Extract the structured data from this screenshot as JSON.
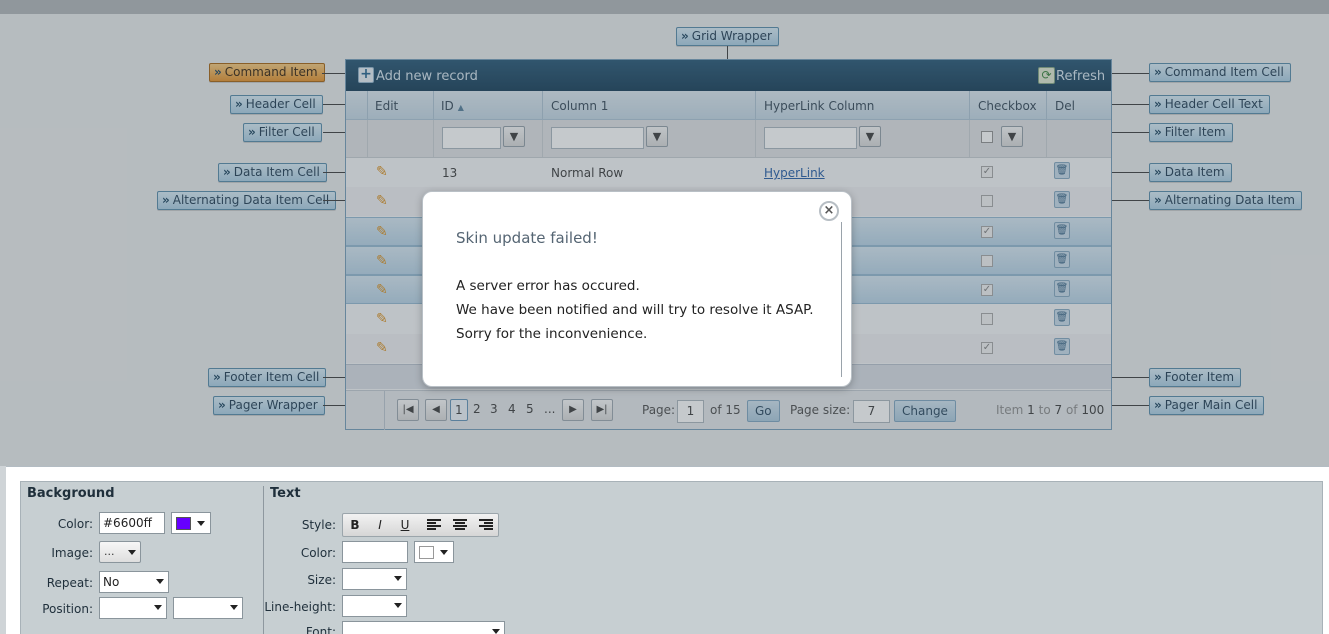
{
  "callouts": {
    "grid_wrapper": "Grid Wrapper",
    "command_item": "Command Item",
    "command_item_cell": "Command Item Cell",
    "header_cell": "Header Cell",
    "header_cell_text": "Header Cell Text",
    "filter_cell": "Filter Cell",
    "filter_item": "Filter Item",
    "data_item_cell": "Data Item Cell",
    "data_item": "Data Item",
    "alternating_data_item_cell": "Alternating Data Item Cell",
    "alternating_data_item": "Alternating Data Item",
    "footer_item_cell": "Footer Item Cell",
    "footer_item": "Footer Item",
    "pager_wrapper": "Pager Wrapper",
    "pager_main_cell": "Pager Main Cell"
  },
  "grid": {
    "command": {
      "add_label": "Add new record",
      "refresh_label": "Refresh"
    },
    "headers": {
      "edit": "Edit",
      "id": "ID",
      "column1": "Column 1",
      "hyperlink": "HyperLink Column",
      "checkbox": "Checkbox",
      "del": "Del"
    },
    "first_row": {
      "id": "13",
      "column1": "Normal Row",
      "link": "HyperLink"
    },
    "row_checks": [
      "✓",
      "",
      "✓",
      "",
      "✓",
      "",
      "✓"
    ],
    "pager": {
      "pages": [
        "1",
        "2",
        "3",
        "4",
        "5",
        "..."
      ],
      "page_label": "Page:",
      "page_value": "1",
      "of_label": "of 15",
      "go_label": "Go",
      "page_size_label": "Page size:",
      "page_size_value": "7",
      "change_label": "Change",
      "item_text_prefix": "Item",
      "item_from": "1",
      "item_to_label": "to",
      "item_to": "7",
      "item_of_label": "of",
      "item_total": "100"
    }
  },
  "dialog": {
    "title": "Skin update failed!",
    "line1": "A server error has occured.",
    "line2": "We have been notified and will try to resolve it ASAP.",
    "line3": "Sorry for the inconvenience.",
    "close_glyph": "×"
  },
  "editor": {
    "background": {
      "title": "Background",
      "color_label": "Color:",
      "color_value": "#6600ff",
      "swatch_color": "#6600ff",
      "image_label": "Image:",
      "image_button": "...",
      "repeat_label": "Repeat:",
      "repeat_value": "No",
      "position_label": "Position:"
    },
    "text": {
      "title": "Text",
      "style_label": "Style:",
      "bold": "B",
      "italic": "I",
      "underline": "U",
      "color_label": "Color:",
      "size_label": "Size:",
      "line_height_label": "Line-height:",
      "font_label": "Font:"
    }
  }
}
